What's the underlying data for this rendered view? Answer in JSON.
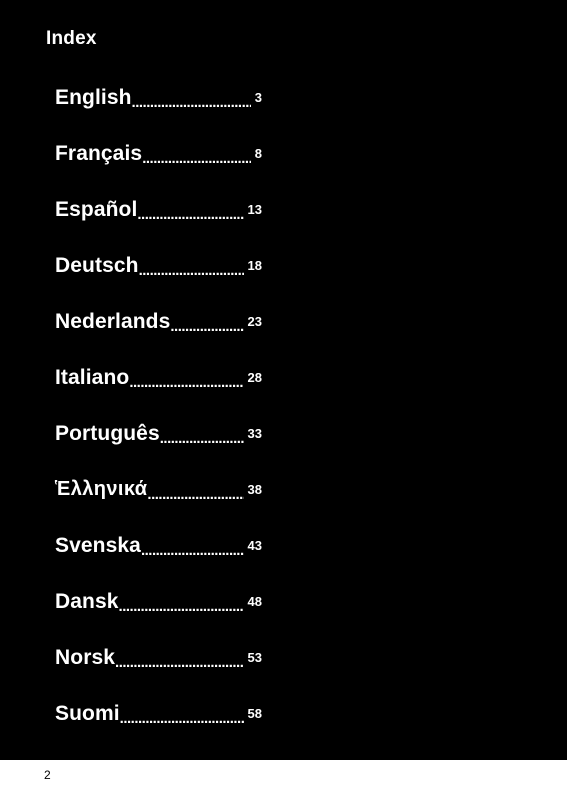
{
  "document": {
    "header_title": "Index",
    "folio": "2",
    "dot_leader": "......................................................",
    "colors": {
      "panel_background": "#000000",
      "text": "#ffffff",
      "page_background": "#ffffff",
      "folio_text": "#000000"
    },
    "index_entries": [
      {
        "language": "English",
        "page": "3"
      },
      {
        "language": "Français",
        "page": "8"
      },
      {
        "language": "Español",
        "page": "13"
      },
      {
        "language": "Deutsch",
        "page": "18"
      },
      {
        "language": "Nederlands",
        "page": "23"
      },
      {
        "language": "Italiano",
        "page": "28"
      },
      {
        "language": "Português",
        "page": "33"
      },
      {
        "language": "Ἑλληνικά",
        "page": "38"
      },
      {
        "language": "Svenska",
        "page": "43"
      },
      {
        "language": "Dansk",
        "page": "48"
      },
      {
        "language": "Norsk",
        "page": "53"
      },
      {
        "language": "Suomi",
        "page": "58"
      }
    ]
  }
}
